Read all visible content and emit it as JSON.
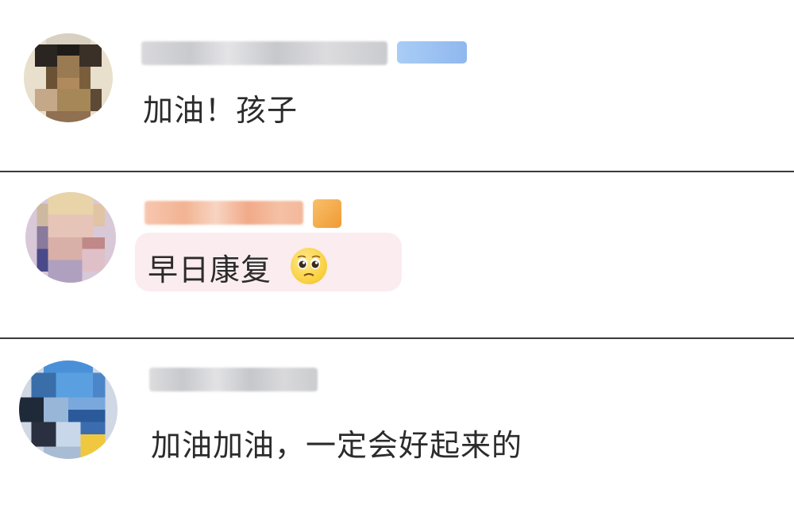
{
  "comments": [
    {
      "text": "加油！孩子"
    },
    {
      "text": "早日康复",
      "emoji": "pleading-face-icon"
    },
    {
      "text": "加油加油，一定会好起来的"
    }
  ],
  "colors": {
    "text": "#2b2b2b",
    "divider": "#3a3a3a",
    "bubble": "#fbecef",
    "vip_badge": "#9fc4f0",
    "fan_badge": "#f4a646"
  }
}
